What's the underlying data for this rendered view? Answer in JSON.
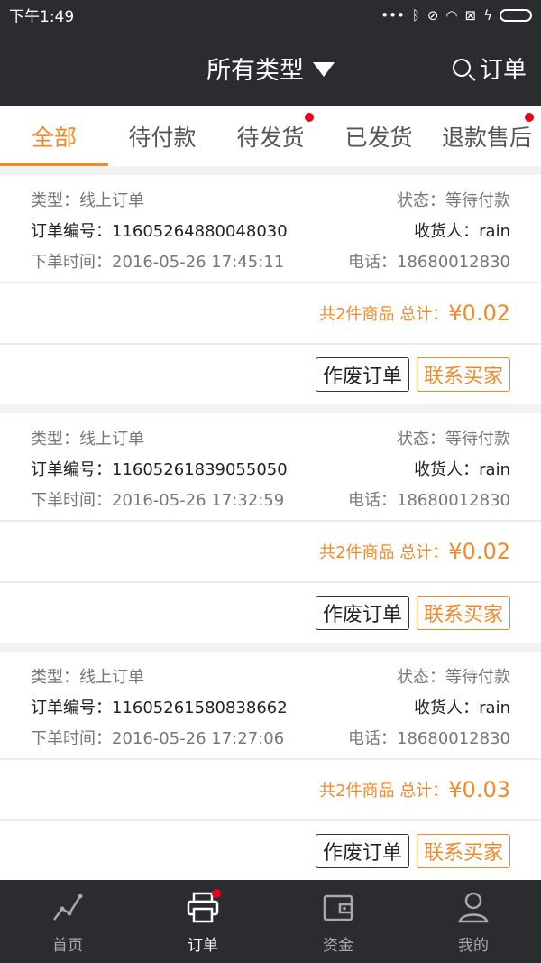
{
  "status_bar": {
    "time": "下午1:49",
    "icons": [
      "dots",
      "bluetooth-icon",
      "mute-icon",
      "wifi-icon",
      "sim-icon",
      "battery-icon"
    ]
  },
  "header": {
    "title": "所有类型",
    "search_label": "订单"
  },
  "tabs": [
    {
      "label": "全部",
      "active": true,
      "badge": false
    },
    {
      "label": "待付款",
      "active": false,
      "badge": false
    },
    {
      "label": "待发货",
      "active": false,
      "badge": true
    },
    {
      "label": "已发货",
      "active": false,
      "badge": false
    },
    {
      "label": "退款售后",
      "active": false,
      "badge": true
    }
  ],
  "orders": [
    {
      "type": "类型：线上订单",
      "status": "状态：等待付款",
      "order_no": "订单编号：11605264880048030",
      "receiver": "收货人：rain",
      "time": "下单时间：2016-05-26 17:45:11",
      "phone": "电话：18680012830",
      "total_label": "共2件商品 总计：",
      "total_amount": "¥0.02",
      "cancel_label": "作废订单",
      "contact_label": "联系买家"
    },
    {
      "type": "类型：线上订单",
      "status": "状态：等待付款",
      "order_no": "订单编号：11605261839055050",
      "receiver": "收货人：rain",
      "time": "下单时间：2016-05-26 17:32:59",
      "phone": "电话：18680012830",
      "total_label": "共2件商品 总计：",
      "total_amount": "¥0.02",
      "cancel_label": "作废订单",
      "contact_label": "联系买家"
    },
    {
      "type": "类型：线上订单",
      "status": "状态：等待付款",
      "order_no": "订单编号：11605261580838662",
      "receiver": "收货人：rain",
      "time": "下单时间：2016-05-26 17:27:06",
      "phone": "电话：18680012830",
      "total_label": "共2件商品 总计：",
      "total_amount": "¥0.03",
      "cancel_label": "作废订单",
      "contact_label": "联系买家"
    }
  ],
  "bottom_nav": [
    {
      "label": "首页",
      "icon": "chart-line-icon",
      "active": false
    },
    {
      "label": "订单",
      "icon": "printer-icon",
      "active": true
    },
    {
      "label": "资金",
      "icon": "wallet-icon",
      "active": false
    },
    {
      "label": "我的",
      "icon": "user-icon",
      "active": false
    }
  ],
  "colors": {
    "accent": "#f08a2c",
    "dark_bar": "#2b2c30",
    "badge": "#e6001c"
  }
}
